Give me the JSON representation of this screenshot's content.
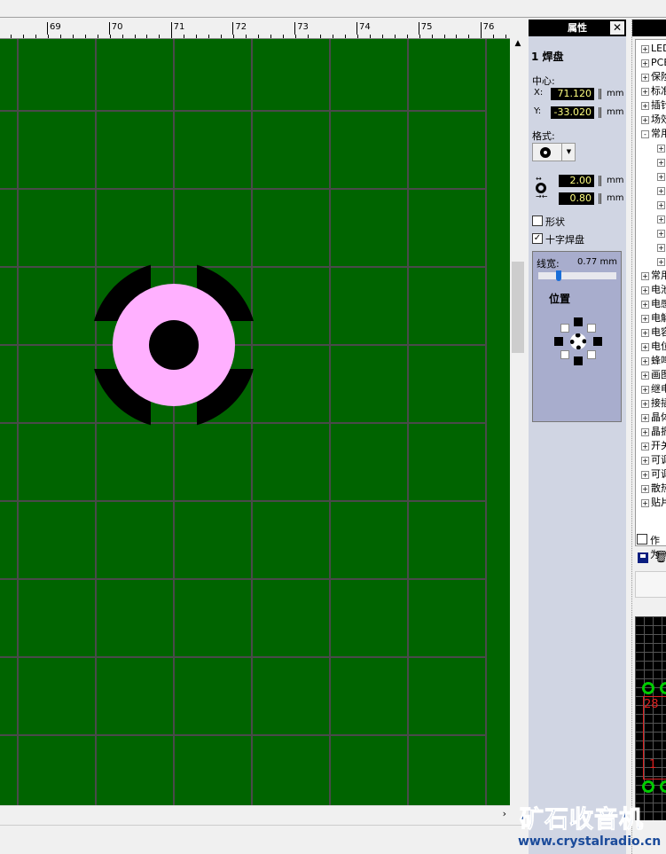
{
  "ruler": {
    "labels": [
      "69",
      "70",
      "71",
      "72",
      "73",
      "74",
      "75",
      "76"
    ]
  },
  "properties": {
    "title": "属性",
    "close": "✕",
    "object": "1 焊盘",
    "center_label": "中心:",
    "x_label": "X:",
    "x_value": "71.120",
    "y_label": "Y:",
    "y_value": "-33.020",
    "unit": "mm",
    "format_label": "格式:",
    "outer_dia": "2.00",
    "hole_dia": "0.80",
    "shape_label": "形状",
    "shape_checked": false,
    "thermal_label": "十字焊盘",
    "thermal_checked": true,
    "linewidth_label": "线宽:",
    "linewidth_value": "0.77",
    "linewidth_unit": "mm",
    "linewidth_fraction": 0.3,
    "position_label": "位置"
  },
  "tree": {
    "items": [
      {
        "label": "LED",
        "sign": "+"
      },
      {
        "label": "PCB",
        "sign": "+"
      },
      {
        "label": "保险",
        "sign": "+"
      },
      {
        "label": "标准",
        "sign": "+"
      },
      {
        "label": "插针",
        "sign": "+"
      },
      {
        "label": "场效",
        "sign": "+"
      },
      {
        "label": "常用",
        "sign": "-"
      },
      {
        "label": "",
        "sign": "+"
      },
      {
        "label": "",
        "sign": "+"
      },
      {
        "label": "",
        "sign": "+"
      },
      {
        "label": "",
        "sign": "+"
      },
      {
        "label": "",
        "sign": "+"
      },
      {
        "label": "",
        "sign": "+"
      },
      {
        "label": "",
        "sign": "+"
      },
      {
        "label": "",
        "sign": "+"
      },
      {
        "label": "",
        "sign": "+"
      },
      {
        "label": "常用",
        "sign": "+"
      },
      {
        "label": "电池",
        "sign": "+"
      },
      {
        "label": "电感",
        "sign": "+"
      },
      {
        "label": "电解",
        "sign": "+"
      },
      {
        "label": "电容",
        "sign": "+"
      },
      {
        "label": "电位",
        "sign": "+"
      },
      {
        "label": "蜂鸣",
        "sign": "+"
      },
      {
        "label": "画图",
        "sign": "+"
      },
      {
        "label": "继电",
        "sign": "+"
      },
      {
        "label": "接插",
        "sign": "+"
      },
      {
        "label": "晶体",
        "sign": "+"
      },
      {
        "label": "晶振",
        "sign": "+"
      },
      {
        "label": "开关",
        "sign": "+"
      },
      {
        "label": "可调",
        "sign": "+"
      },
      {
        "label": "可调",
        "sign": "+"
      },
      {
        "label": "散热",
        "sign": "+"
      },
      {
        "label": "贴片",
        "sign": "+"
      }
    ],
    "as_label": "作为",
    "preview_pin_top": "28",
    "preview_pin_bottom": "1"
  },
  "watermark": {
    "title": "矿石收音机",
    "url": "www.crystalradio.cn"
  },
  "colors": {
    "board": "#006400",
    "pad": "#ffb0ff",
    "grid": "#4a4a4a"
  }
}
